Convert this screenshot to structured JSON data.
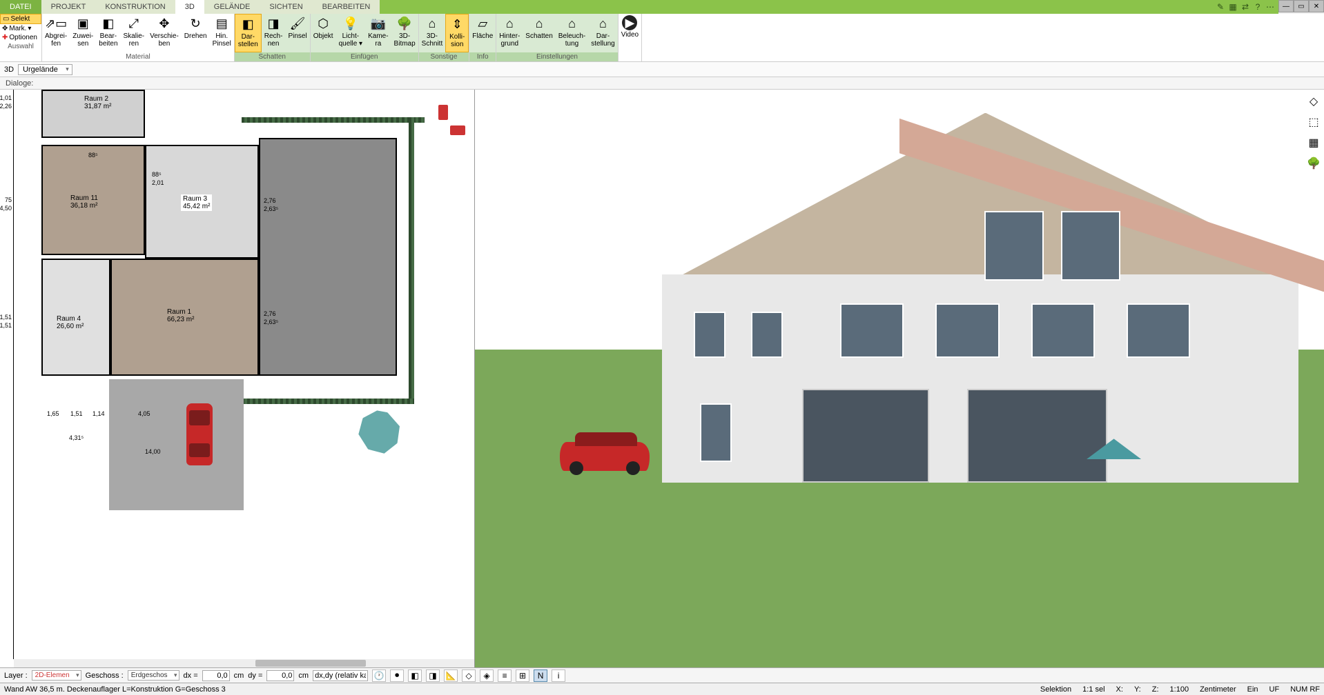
{
  "tabs": {
    "datei": "DATEI",
    "projekt": "PROJEKT",
    "konstruktion": "KONSTRUKTION",
    "dd": "3D",
    "gelaende": "GELÄNDE",
    "sichten": "SICHTEN",
    "bearbeiten": "BEARBEITEN"
  },
  "menu_icons": {
    "i1": "✎",
    "i2": "▦",
    "i3": "⇄",
    "i4": "?",
    "i5": "⋯"
  },
  "win": {
    "min": "—",
    "max": "▭",
    "close": "✕"
  },
  "ribbon_left": {
    "select": "Selekt",
    "mark": "Mark.",
    "options": "Optionen",
    "group": "Auswahl"
  },
  "ribbon": {
    "material": {
      "label": "Material",
      "abgreifen": "Abgrei-\nfen",
      "zuweisen": "Zuwei-\nsen",
      "bearbeiten": "Bear-\nbeiten",
      "skalieren": "Skalie-\nren",
      "verschieben": "Verschie-\nben",
      "drehen": "Drehen",
      "hinpinsel": "Hin.\nPinsel"
    },
    "schatten": {
      "label": "Schatten",
      "darstellen": "Dar-\nstellen",
      "rechnen": "Rech-\nnen",
      "pinsel": "Pinsel"
    },
    "einfuegen": {
      "label": "Einfügen",
      "objekt": "Objekt",
      "licht": "Licht-\nquelle ▾",
      "kamera": "Kame-\nra",
      "bitmap": "3D-\nBitmap"
    },
    "sonstige": {
      "label": "Sonstige",
      "schnitt": "3D-\nSchnitt",
      "kollision": "Kolli-\nsion"
    },
    "info": {
      "label": "Info",
      "flaeche": "Fläche"
    },
    "einstellungen": {
      "label": "Einstellungen",
      "hintergrund": "Hinter-\ngrund",
      "schatten": "Schatten",
      "beleuchtung": "Beleuch-\ntung",
      "darstellung": "Dar-\nstellung"
    },
    "video": {
      "label": "Video"
    }
  },
  "subbar": {
    "mode": "3D",
    "layer": "Urgelände"
  },
  "dialoge": "Dialoge:",
  "rooms": {
    "r2": "Raum 2\n31,87 m²",
    "r11": "Raum 11\n36,18 m²",
    "r3": "Raum 3\n45,42 m²",
    "r4": "Raum 4\n26,60 m²",
    "r1": "Raum 1\n66,23 m²"
  },
  "dims": {
    "d101": "1,01",
    "d226": "2,26",
    "d75": "75",
    "d450": "4,50",
    "d151a": "1,51",
    "d151b": "1,51",
    "d88a": "88⁵",
    "d201": "2,01",
    "d88b": "88⁵",
    "d276a": "2,76",
    "d263a": "2,63⁵",
    "d276b": "2,76",
    "d263b": "2,63⁵",
    "d165": "1,65",
    "d151c": "1,51",
    "d114": "1,14",
    "d405": "4,05",
    "d431": "4,31⁵",
    "d1400": "14,00"
  },
  "bottom": {
    "layer_lbl": "Layer :",
    "layer_val": "2D-Elemen",
    "geschoss_lbl": "Geschoss :",
    "geschoss_val": "Erdgeschos",
    "dx": "dx =",
    "dx_val": "0,0",
    "dy": "dy =",
    "dy_val": "0,0",
    "cm": "cm",
    "desc": "dx,dy (relativ ka"
  },
  "status": {
    "left": "Wand AW 36,5 m. Deckenauflager L=Konstruktion G=Geschoss 3",
    "selection": "Selektion",
    "sel": "1:1 sel",
    "x": "X:",
    "y": "Y:",
    "z": "Z:",
    "scale": "1:100",
    "unit": "Zentimeter",
    "ein": "Ein",
    "uf": "UF",
    "num": "NUM RF"
  },
  "side": {
    "t1": "◇",
    "t2": "⬚",
    "t3": "▦",
    "t4": "🌳"
  }
}
